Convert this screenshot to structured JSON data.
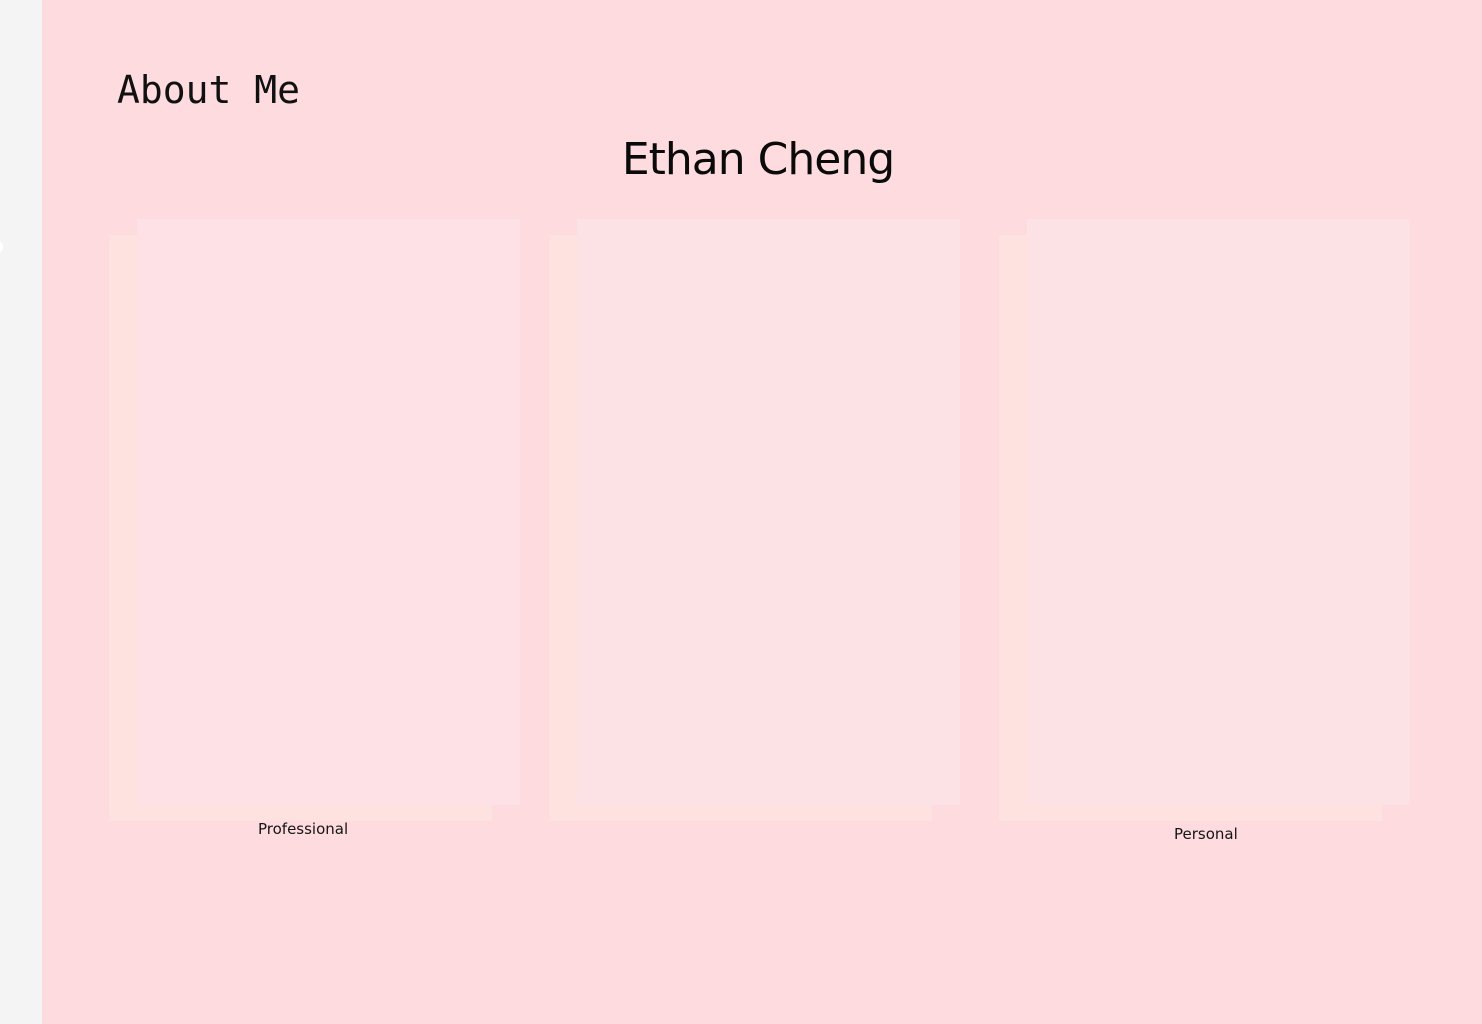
{
  "about": {
    "heading": "About Me",
    "name": "Ethan Cheng"
  },
  "cards": [
    {
      "caption": "Professional"
    },
    {
      "caption": ""
    },
    {
      "caption": "Personal"
    }
  ],
  "colors": {
    "page_background": "#fddbdf",
    "sidebar_background": "#f4f4f4",
    "card_front": "#fde2e5",
    "card_back": "#fde2df"
  }
}
